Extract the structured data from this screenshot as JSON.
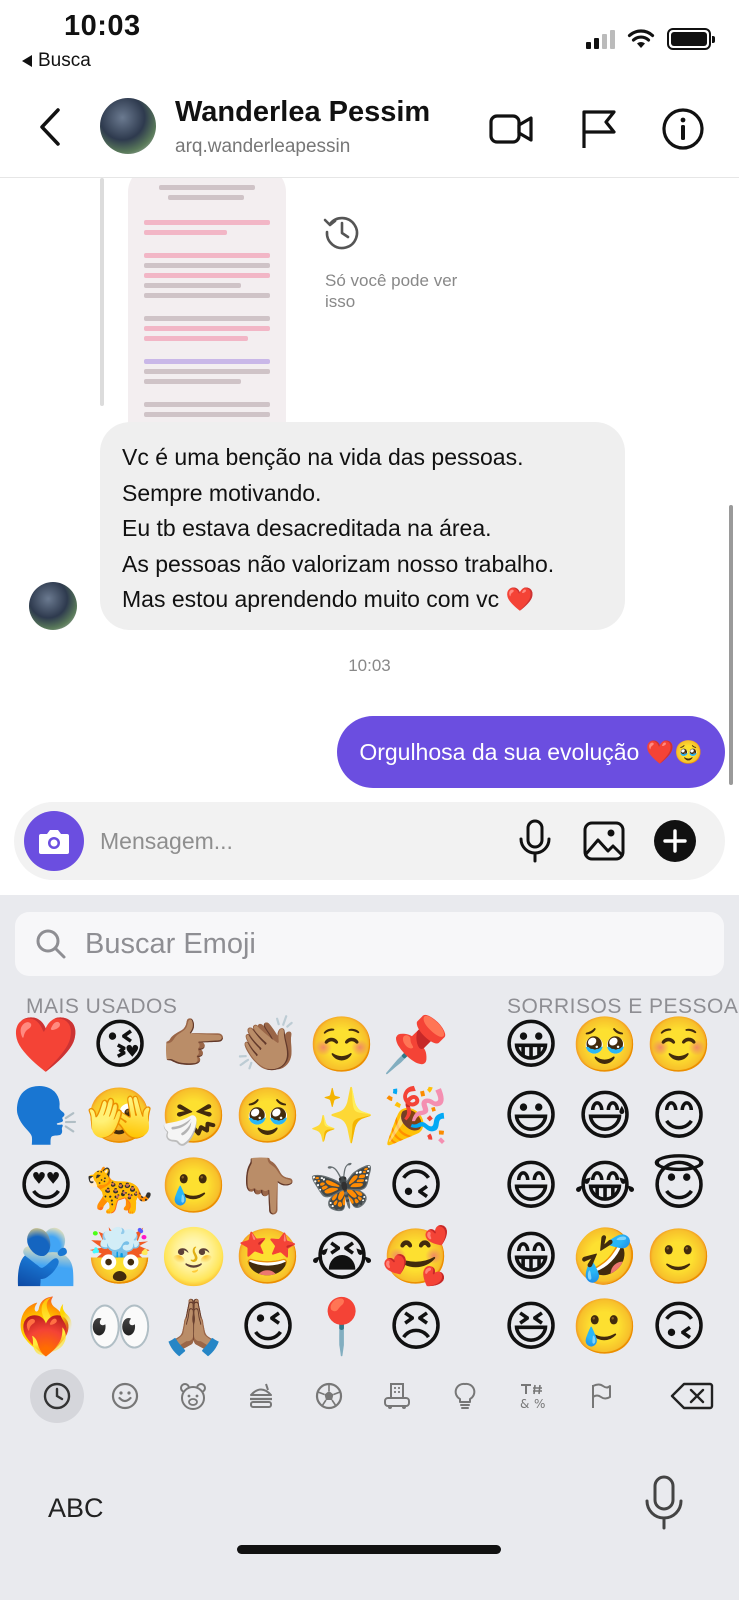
{
  "status": {
    "time": "10:03",
    "back_label": "Busca"
  },
  "header": {
    "name": "Wanderlea Pessim",
    "username": "arq.wanderleapessin"
  },
  "chat": {
    "shared_note": "Só você pode ver isso",
    "incoming_lines": [
      "Vc é uma benção na vida das pessoas.",
      "Sempre motivando.",
      "Eu tb estava desacreditada na área.",
      "As pessoas não valorizam nosso trabalho.",
      "Mas estou aprendendo muito com vc ❤️"
    ],
    "timestamp": "10:03",
    "outgoing": "Orgulhosa da sua evolução ❤️🥹"
  },
  "composer": {
    "placeholder": "Mensagem..."
  },
  "keyboard": {
    "search_placeholder": "Buscar Emoji",
    "section_frequent": "MAIS USADOS",
    "section_smileys": "SORRISOS E PESSOAS",
    "frequent": [
      [
        "❤️",
        "😘",
        "👉🏽",
        "👏🏽",
        "☺️",
        "📌"
      ],
      [
        "🗣️",
        "🫣",
        "🤧",
        "🥹",
        "✨",
        "🎉"
      ],
      [
        "😍",
        "🐆",
        "🥲",
        "👇🏽",
        "🦋",
        "🙃"
      ],
      [
        "🫂",
        "🤯",
        "🌝",
        "🤩",
        "😭",
        "🥰"
      ],
      [
        "❤️‍🔥",
        "👀",
        "🙏🏽",
        "😉",
        "📍",
        "😣"
      ]
    ],
    "smileys": [
      [
        "😀",
        "🥹",
        "☺️"
      ],
      [
        "😃",
        "😅",
        "😊"
      ],
      [
        "😄",
        "😂",
        "😇"
      ],
      [
        "😁",
        "🤣",
        "🙂"
      ],
      [
        "😆",
        "🥲",
        "🙃"
      ]
    ],
    "abc_label": "ABC",
    "accent_color": "#6b4ee0"
  }
}
